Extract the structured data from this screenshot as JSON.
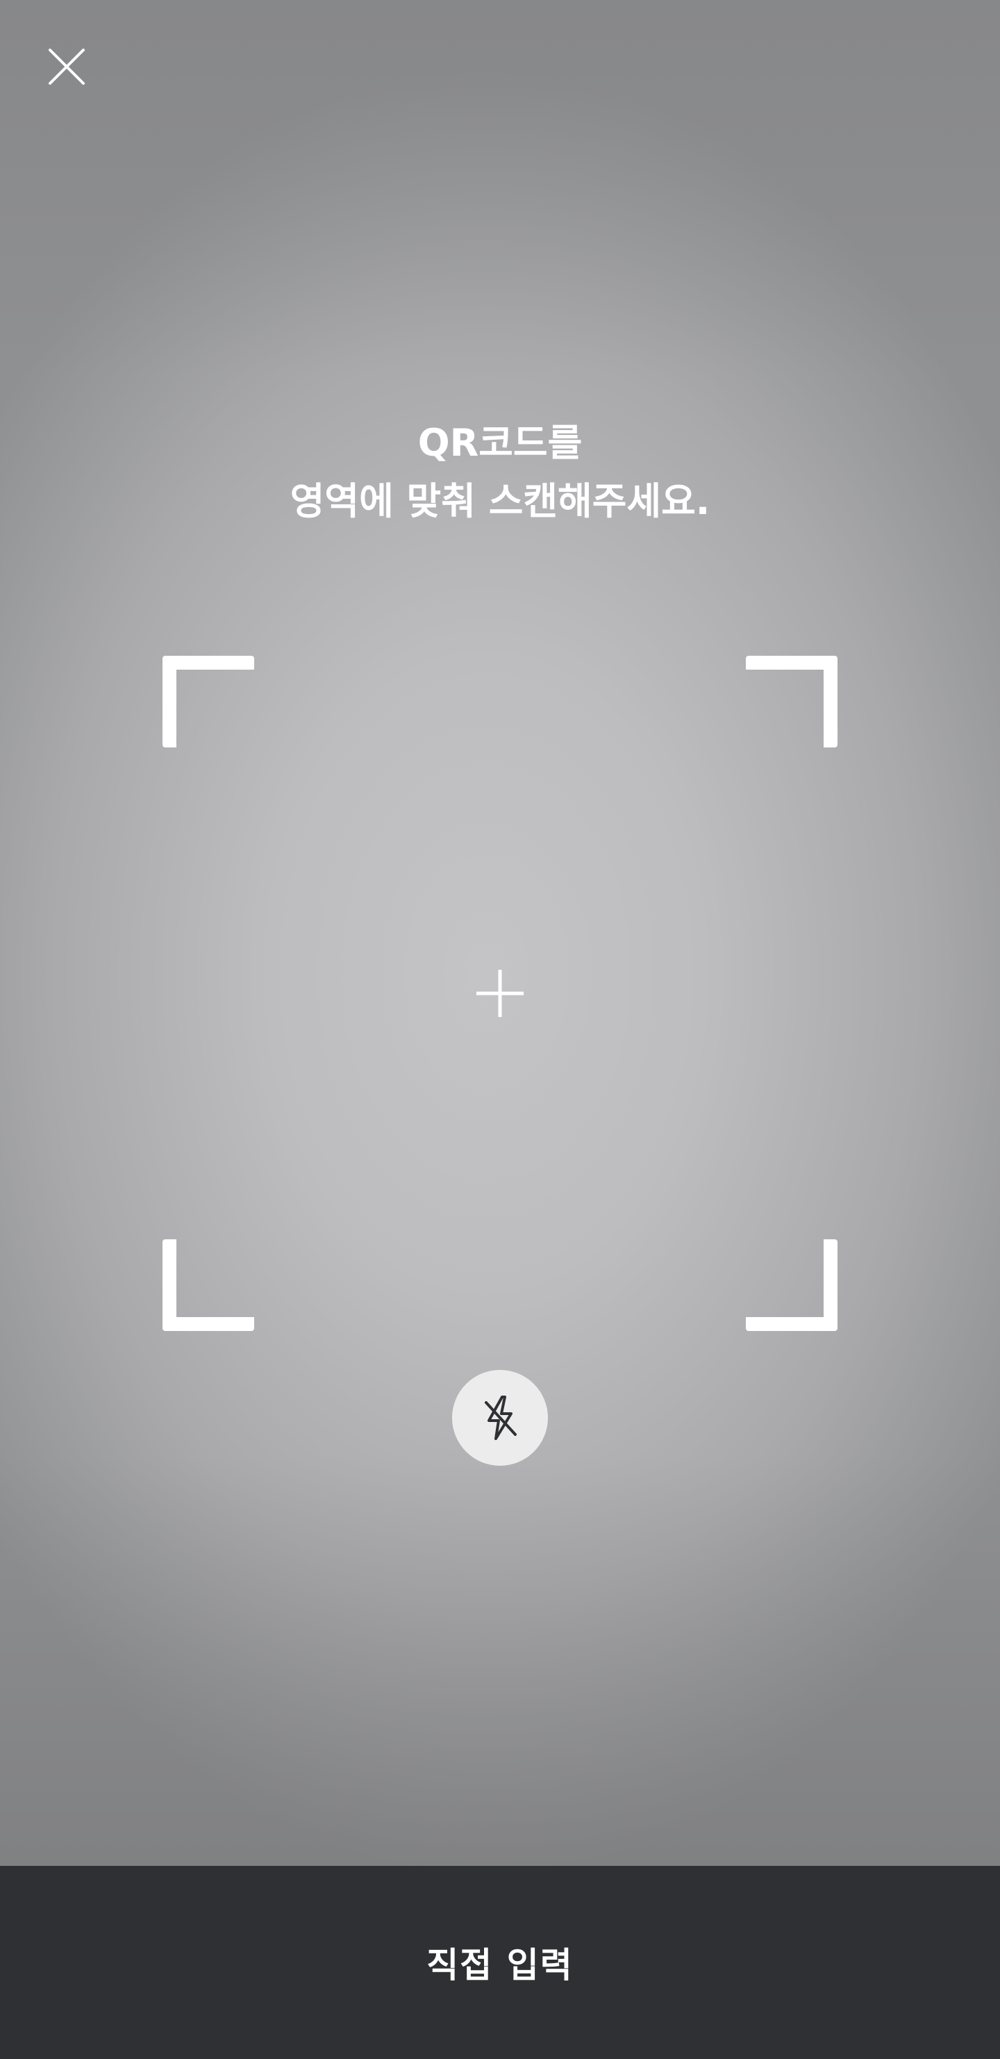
{
  "scanner": {
    "instruction_line1": "QR코드를",
    "instruction_line2": "영역에 맞춰 스캔해주세요.",
    "flash_state": "off"
  },
  "bottom_bar": {
    "manual_entry_label": "직접 입력"
  },
  "icons": {
    "close": "close-icon",
    "crosshair": "crosshair-icon",
    "flash": "flash-off-icon"
  },
  "colors": {
    "bottom_bar": "#2f3033",
    "overlay_text": "#ffffff",
    "flash_button_bg": "#ececec"
  }
}
